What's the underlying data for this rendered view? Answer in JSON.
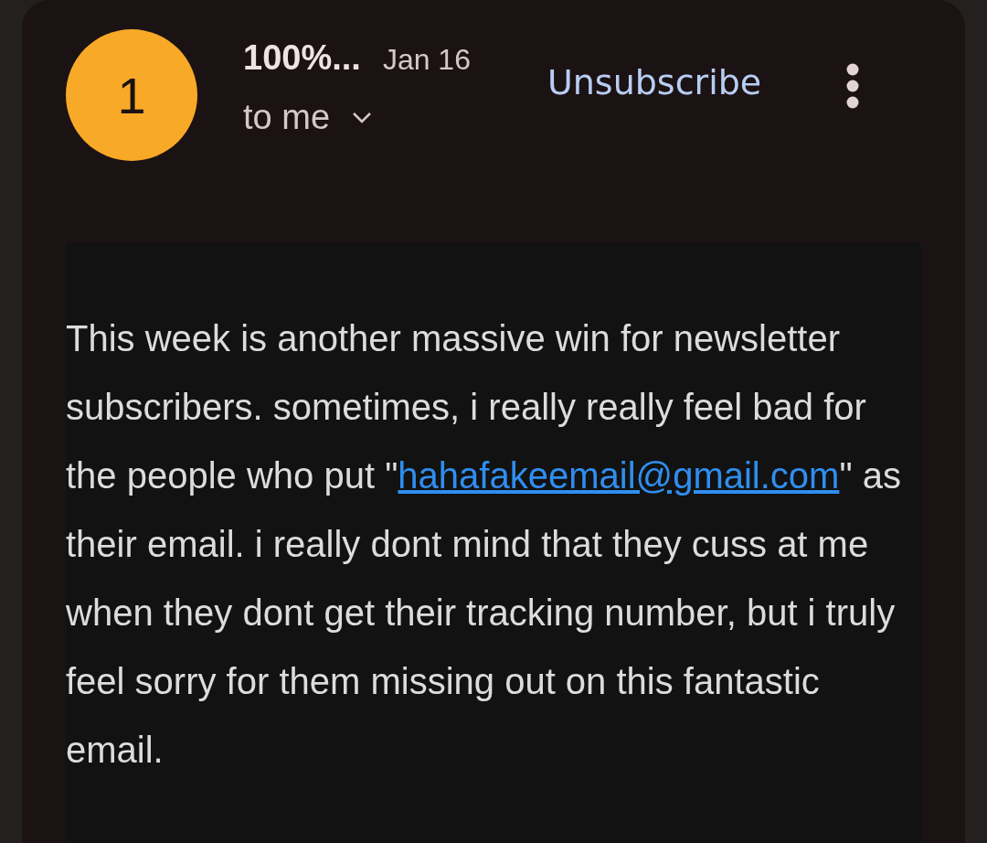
{
  "message": {
    "avatar_letter": "1",
    "sender": "100%...",
    "date": "Jan 16",
    "recipient": "to me",
    "unsubscribe": "Unsubscribe",
    "body": {
      "before": "This week is another massive win for newsletter subscribers. sometimes, i really really feel bad for the people who put \"",
      "link": "hahafakeemail@gmail.com",
      "after": "\" as their email. i really dont mind that they cuss at me when they dont get their tracking number, but i truly feel sorry for them missing out on this fantastic email."
    }
  }
}
